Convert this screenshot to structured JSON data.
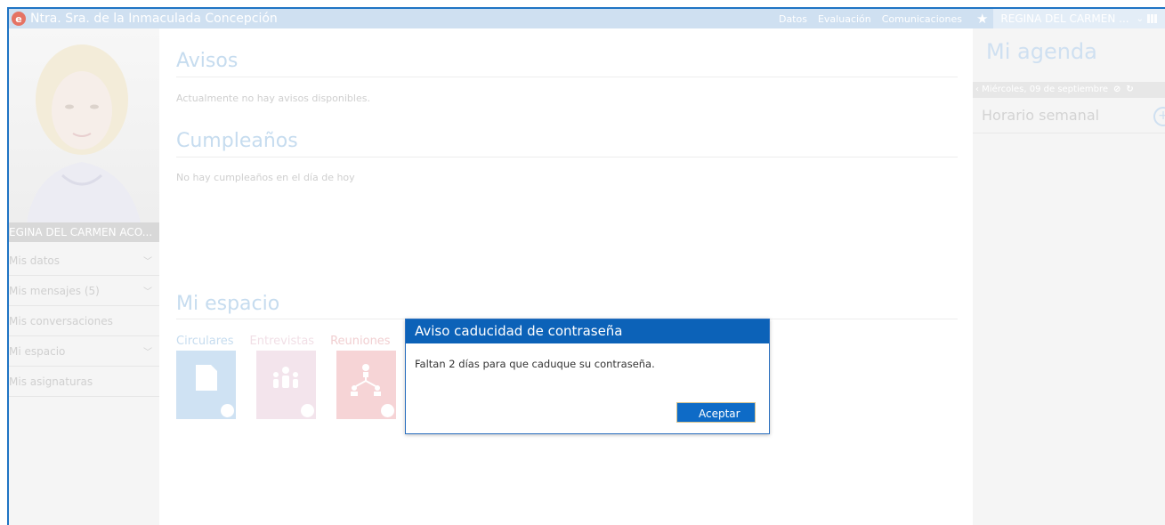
{
  "topbar": {
    "app_title": "Ntra. Sra. de la Inmaculada Concepción",
    "logo_letter": "e",
    "nav": [
      "Datos",
      "Evaluación",
      "Comunicaciones"
    ],
    "user_name": "REGINA DEL CARMEN ..."
  },
  "sidebar": {
    "profile_name": "EGINA DEL CARMEN ACO...",
    "menu": [
      {
        "label": "Mis datos",
        "expandable": true
      },
      {
        "label": "Mis mensajes (5)",
        "expandable": true
      },
      {
        "label": "Mis conversaciones",
        "expandable": false
      },
      {
        "label": "Mi espacio",
        "expandable": true
      },
      {
        "label": "Mis asignaturas",
        "expandable": false
      }
    ]
  },
  "main": {
    "avisos_title": "Avisos",
    "avisos_text": "Actualmente no hay avisos disponibles.",
    "cumple_title": "Cumpleaños",
    "cumple_text": "No hay cumpleaños en el día de hoy",
    "espacio_title": "Mi espacio",
    "tabs": [
      "Circulares",
      "Entrevistas",
      "Reuniones"
    ],
    "tile_colors": [
      "#cfe2f3",
      "#f3e4ec",
      "#f6d4d6"
    ]
  },
  "agenda": {
    "title": "Mi agenda",
    "date": "‹ Miércoles, 09 de septiembre",
    "schedule_label": "Horario semanal"
  },
  "modal": {
    "title": "Aviso caducidad de contraseña",
    "message": "Faltan 2 días para que caduque su contraseña.",
    "button": "Aceptar"
  },
  "colors": {
    "accent": "#0c62b8",
    "topbar": "#cfe0f1"
  }
}
